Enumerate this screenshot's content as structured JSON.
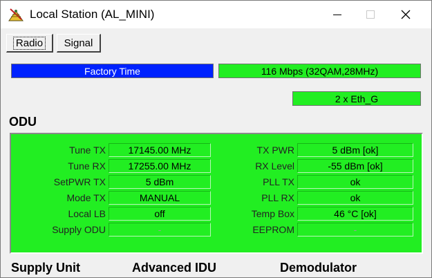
{
  "window": {
    "title": "Local Station (AL_MINI)",
    "controls": {
      "minimize": "—",
      "maximize": "□",
      "close": "✕"
    }
  },
  "tabs": [
    {
      "label": "Radio",
      "active": true
    },
    {
      "label": "Signal",
      "active": false
    }
  ],
  "status": {
    "factory_time": "Factory Time",
    "data_rate": "116 Mbps (32QAM,28MHz)",
    "ethernet": "2 x Eth_G"
  },
  "odu": {
    "title": "ODU",
    "left": [
      {
        "label": "Tune TX",
        "value": "17145.00 MHz"
      },
      {
        "label": "Tune RX",
        "value": "17255.00 MHz"
      },
      {
        "label": "SetPWR TX",
        "value": "5 dBm"
      },
      {
        "label": "Mode TX",
        "value": "MANUAL"
      },
      {
        "label": "Local LB",
        "value": "off"
      },
      {
        "label": "Supply ODU",
        "value": "-"
      }
    ],
    "right": [
      {
        "label": "TX PWR",
        "value": "5 dBm [ok]"
      },
      {
        "label": "RX Level",
        "value": "-55 dBm [ok]"
      },
      {
        "label": "PLL TX",
        "value": "ok"
      },
      {
        "label": "PLL RX",
        "value": "ok"
      },
      {
        "label": "Temp Box",
        "value": "46 °C [ok]"
      },
      {
        "label": "EEPROM",
        "value": "-"
      }
    ]
  },
  "sections": [
    "Supply Unit",
    "Advanced IDU",
    "Demodulator"
  ],
  "colors": {
    "status_green": "#22ee22",
    "factory_blue": "#0022ff"
  }
}
